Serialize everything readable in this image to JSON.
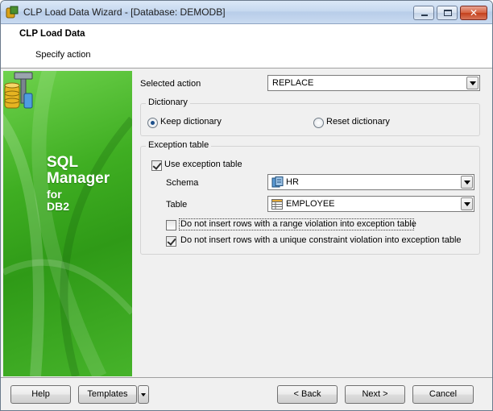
{
  "window": {
    "title": "CLP Load Data Wizard - [Database: DEMODB]",
    "close_glyph": "✕"
  },
  "header": {
    "title": "CLP Load Data",
    "subtitle": "Specify action"
  },
  "banner": {
    "line1": "SQL",
    "line2": "Manager",
    "line3": "for",
    "line4": "DB2",
    "color": "#3fae22"
  },
  "selected_action": {
    "label": "Selected action",
    "value": "REPLACE"
  },
  "dictionary": {
    "title": "Dictionary",
    "keep_label": "Keep dictionary",
    "reset_label": "Reset dictionary",
    "selected": "keep"
  },
  "exception": {
    "title": "Exception table",
    "use_label": "Use exception table",
    "use_checked": true,
    "schema_label": "Schema",
    "schema_value": "HR",
    "table_label": "Table",
    "table_value": "EMPLOYEE",
    "range_label": "Do not insert rows with a range violation into exception table",
    "range_checked": false,
    "unique_label": "Do not insert rows with a unique constraint violation into exception table",
    "unique_checked": true
  },
  "footer": {
    "help": "Help",
    "templates": "Templates",
    "back": "< Back",
    "next": "Next >",
    "cancel": "Cancel"
  },
  "icons": [
    "app-icon",
    "minimize-icon",
    "maximize-icon",
    "close-icon",
    "sql-manager-logo",
    "schema-icon",
    "table-icon",
    "chevron-down-icon"
  ]
}
